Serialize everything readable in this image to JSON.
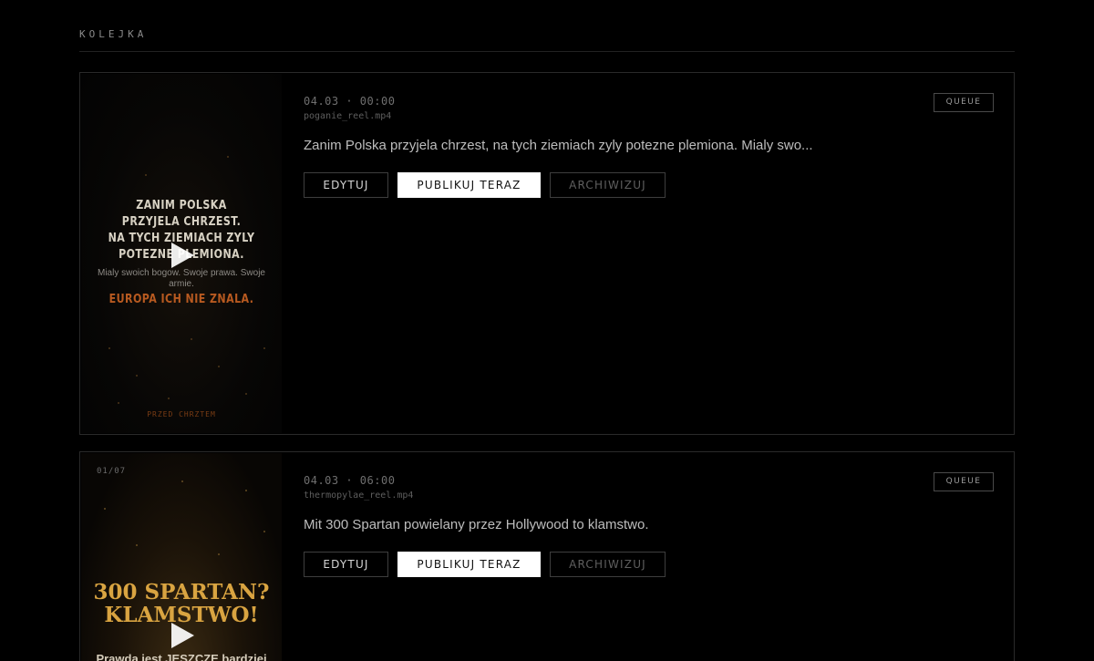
{
  "section": {
    "title": "KOLEJKA"
  },
  "items": [
    {
      "date": "04.03 · 00:00",
      "filename": "poganie_reel.mp4",
      "caption": "Zanim Polska przyjela chrzest, na tych ziemiach zyly potezne plemiona. Mialy swo...",
      "status": "QUEUE",
      "buttons": {
        "edit": "EDYTUJ",
        "publish": "PUBLIKUJ TERAZ",
        "archive": "ARCHIWIZUJ"
      },
      "thumbnail": {
        "headline": "ZANIM POLSKA\nPRZYJELA CHRZEST.\nNA TYCH ZIEMIACH ZYLY\nPOTEZNE PLEMIONA.",
        "subtext": "Mialy swoich bogow. Swoje prawa. Swoje armie.",
        "accent": "EUROPA ICH NIE ZNALA.",
        "footer": "PRZED CHRZTEM"
      }
    },
    {
      "date": "04.03 · 06:00",
      "filename": "thermopylae_reel.mp4",
      "caption": "Mit 300 Spartan powielany przez Hollywood to klamstwo.",
      "status": "QUEUE",
      "buttons": {
        "edit": "EDYTUJ",
        "publish": "PUBLIKUJ TERAZ",
        "archive": "ARCHIWIZUJ"
      },
      "thumbnail": {
        "counter": "01/07",
        "headline": "300 SPARTAN?\nKLAMSTWO!",
        "subtext": "Prawda jest JESZCZE bardziej"
      }
    }
  ],
  "colors": {
    "background": "#000000",
    "card_border": "#2a2a2a",
    "publish_button_bg": "#ffffff",
    "accent_orange": "#b85a20",
    "accent_gold": "#d9a441"
  },
  "icons": {
    "thumbnail_overlay": "play-icon"
  }
}
